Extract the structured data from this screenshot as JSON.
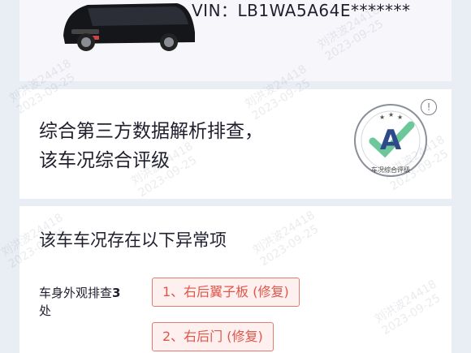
{
  "vehicle": {
    "vin": "VIN：LB1WA5A64E*******"
  },
  "rating": {
    "line1": "综合第三方数据解析排查，",
    "line2": "该车况综合评级",
    "grade": "A",
    "badge_caption": "车况综合评级",
    "info_symbol": "!"
  },
  "anomaly": {
    "title": "该车车况存在以下异常项",
    "category_label": "车身外观排查",
    "category_count": "3",
    "category_suffix": "处",
    "items": [
      "1、右后翼子板 (修复)",
      "2、右后门 (修复)"
    ]
  },
  "watermark": {
    "user": "刘洪波24418",
    "date": "2023-09-25"
  },
  "colors": {
    "grade_green": "#6cc79a",
    "grade_blue": "#2f4a8a",
    "tag_red": "#e0554a"
  }
}
